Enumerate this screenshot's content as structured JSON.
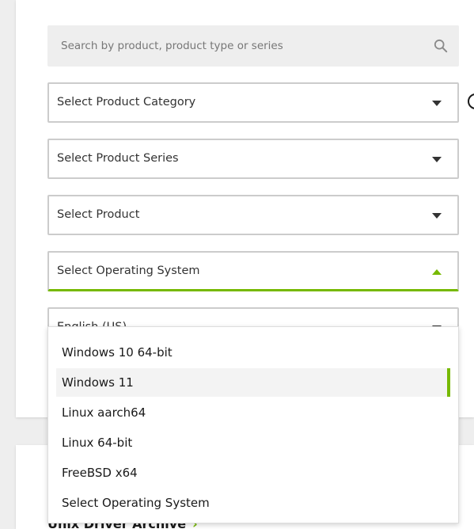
{
  "search": {
    "placeholder": "Search by product, product type or series",
    "icon": "search-icon"
  },
  "selects": [
    {
      "label": "Select Product Category",
      "state": "closed"
    },
    {
      "label": "Select Product Series",
      "state": "closed"
    },
    {
      "label": "Select Product",
      "state": "closed"
    },
    {
      "label": "Select Operating System",
      "state": "open"
    },
    {
      "label": "English (US)",
      "state": "closed"
    }
  ],
  "os_dropdown": {
    "options": [
      "Windows 10 64-bit",
      "Windows 11",
      "Linux aarch64",
      "Linux 64-bit",
      "FreeBSD x64",
      "Select Operating System"
    ],
    "selected": "Windows 11"
  },
  "footer": {
    "archive_link": "Unix Driver Archive"
  },
  "colors": {
    "accent": "#76b900",
    "border": "#cccccc",
    "field_bg": "#eeeeee"
  }
}
